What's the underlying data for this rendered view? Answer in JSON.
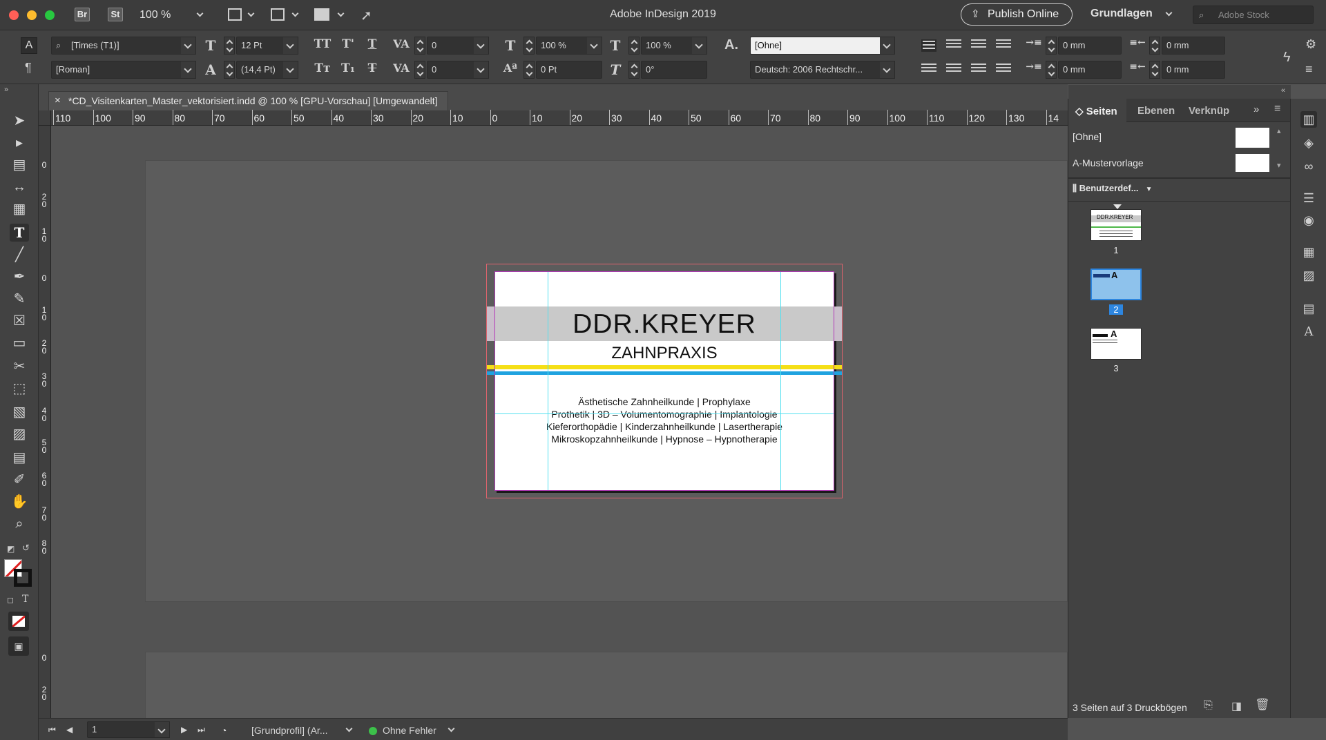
{
  "window": {
    "title": "Adobe InDesign 2019",
    "zoom": "100 %",
    "app_badges": [
      "Br",
      "St"
    ],
    "publish_label": "Publish Online",
    "workspace": "Grundlagen",
    "stock_placeholder": "Adobe Stock"
  },
  "control": {
    "font_family": "[Times (T1)]",
    "font_style": "[Roman]",
    "font_size": "12 Pt",
    "leading": "(14,4 Pt)",
    "kerning": "0",
    "tracking": "0",
    "vertical_scale": "100 %",
    "horizontal_scale": "100 %",
    "baseline_shift": "0 Pt",
    "skew": "0°",
    "char_style": "[Ohne]",
    "language": "Deutsch: 2006 Rechtschr...",
    "left_indent": "0 mm",
    "first_line_indent": "0 mm",
    "right_indent": "0 mm",
    "last_line_indent": "0 mm"
  },
  "document": {
    "tab_title": "*CD_Visitenkarten_Master_vektorisiert.indd @ 100 % [GPU-Vorschau] [Umgewandelt]",
    "ruler_h": [
      "110",
      "100",
      "90",
      "80",
      "70",
      "60",
      "50",
      "40",
      "30",
      "20",
      "10",
      "0",
      "10",
      "20",
      "30",
      "40",
      "50",
      "60",
      "70",
      "80",
      "90",
      "100",
      "110",
      "120",
      "130",
      "14"
    ],
    "ruler_v": [
      "0",
      "20",
      "10",
      "0",
      "10",
      "20",
      "30",
      "40",
      "50",
      "60",
      "70",
      "80",
      "0",
      "20"
    ]
  },
  "card": {
    "name": "DDR.KREYER",
    "subtitle": "ZAHNPRAXIS",
    "services": [
      "Ästhetische Zahnheilkunde | Prophylaxe",
      "Prothetik | 3D – Volumentomographie | Implantologie",
      "Kieferorthopädie | Kinderzahnheilkunde | Lasertherapie",
      "Mikroskopzahnheilkunde | Hypnose – Hypnotherapie"
    ],
    "colors": {
      "band": "#c9c9c9",
      "yellow": "#f5df16",
      "blue": "#1fa3e0"
    }
  },
  "pages_panel": {
    "tabs": [
      "Seiten",
      "Ebenen",
      "Verknüp"
    ],
    "masters": [
      "[Ohne]",
      "A-Mustervorlage"
    ],
    "size_label": "Benutzerdef...",
    "pages": [
      {
        "number": "1",
        "master": "A",
        "selected": false
      },
      {
        "number": "2",
        "master": "A",
        "selected": true
      },
      {
        "number": "3",
        "master": "A",
        "selected": false
      }
    ],
    "footer": "3 Seiten auf 3 Druckbögen"
  },
  "status": {
    "page": "1",
    "profile": "[Grundprofil] (Ar...",
    "errors": "Ohne Fehler"
  }
}
